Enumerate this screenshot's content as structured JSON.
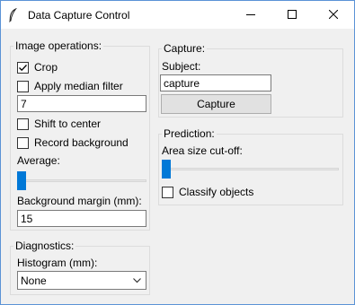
{
  "window": {
    "title": "Data Capture Control"
  },
  "image_ops": {
    "legend": "Image operations:",
    "crop": {
      "label": "Crop",
      "checked": true
    },
    "median": {
      "label": "Apply median filter",
      "checked": false,
      "value": "7"
    },
    "shift": {
      "label": "Shift to center",
      "checked": false
    },
    "record_bg": {
      "label": "Record background",
      "checked": false
    },
    "average_label": "Average:",
    "bg_margin_label": "Background margin (mm):",
    "bg_margin_value": "15"
  },
  "diagnostics": {
    "legend": "Diagnostics:",
    "histogram_label": "Histogram (mm):",
    "histogram_value": "None"
  },
  "capture": {
    "legend": "Capture:",
    "subject_label": "Subject:",
    "subject_value": "capture",
    "button": "Capture"
  },
  "prediction": {
    "legend": "Prediction:",
    "area_label": "Area size cut-off:",
    "classify": {
      "label": "Classify objects",
      "checked": false
    }
  }
}
